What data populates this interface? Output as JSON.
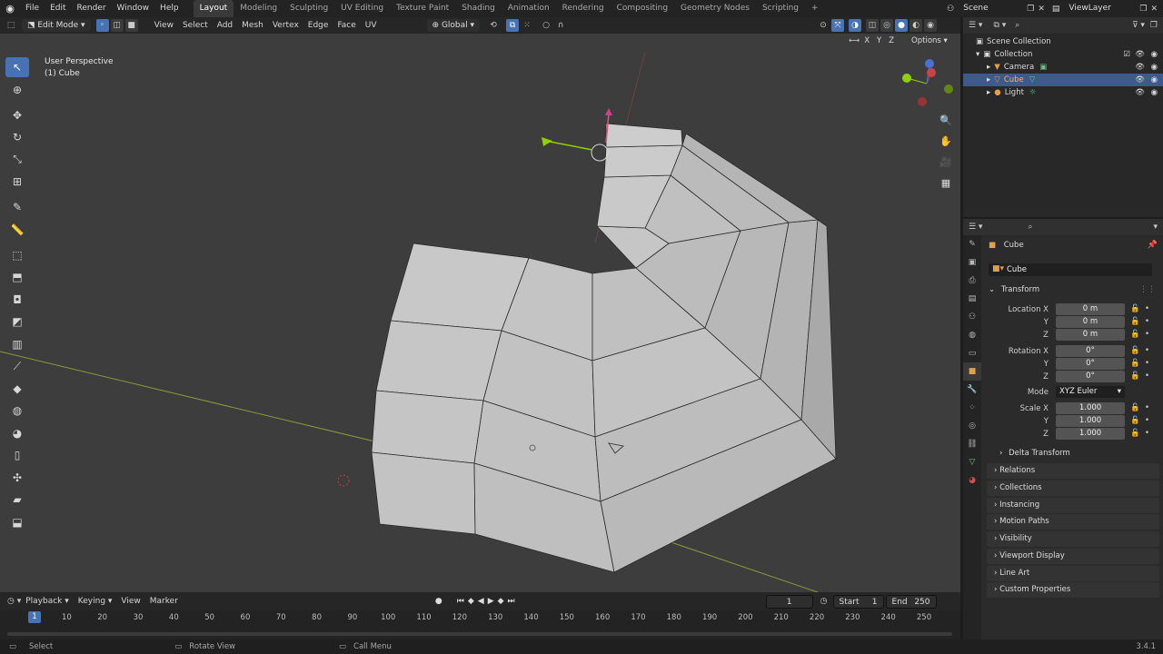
{
  "topbar": {
    "menus": [
      "File",
      "Edit",
      "Render",
      "Window",
      "Help"
    ],
    "workspaces": [
      "Layout",
      "Modeling",
      "Sculpting",
      "UV Editing",
      "Texture Paint",
      "Shading",
      "Animation",
      "Rendering",
      "Compositing",
      "Geometry Nodes",
      "Scripting"
    ],
    "active_workspace": "Layout",
    "add_tab": "+",
    "scene": "Scene",
    "view_layer": "ViewLayer"
  },
  "viewport_header": {
    "mode": "Edit Mode",
    "menus": [
      "View",
      "Select",
      "Add",
      "Mesh",
      "Vertex",
      "Edge",
      "Face",
      "UV"
    ],
    "orientation": "Global",
    "options": "Options"
  },
  "viewport": {
    "perspective": "User Perspective",
    "object": "(1) Cube",
    "xyz": [
      "X",
      "Y",
      "Z"
    ]
  },
  "outliner": {
    "root": "Scene Collection",
    "collection": "Collection",
    "items": [
      "Camera",
      "Cube",
      "Light"
    ],
    "selected": "Cube"
  },
  "properties": {
    "object_name": "Cube",
    "data_name": "Cube",
    "transform_label": "Transform",
    "location_label": "Location X",
    "rotation_label": "Rotation X",
    "scale_label": "Scale X",
    "axis_y": "Y",
    "axis_z": "Z",
    "location": [
      "0 m",
      "0 m",
      "0 m"
    ],
    "rotation": [
      "0°",
      "0°",
      "0°"
    ],
    "mode_label": "Mode",
    "mode_value": "XYZ Euler",
    "scale": [
      "1.000",
      "1.000",
      "1.000"
    ],
    "delta_transform": "Delta Transform",
    "panels": [
      "Relations",
      "Collections",
      "Instancing",
      "Motion Paths",
      "Visibility",
      "Viewport Display",
      "Line Art",
      "Custom Properties"
    ]
  },
  "timeline": {
    "menus": [
      "Playback",
      "Keying",
      "View",
      "Marker"
    ],
    "current_frame": "1",
    "start_label": "Start",
    "start": "1",
    "end_label": "End",
    "end": "250",
    "ticks": [
      {
        "label": "10",
        "f": 10
      },
      {
        "label": "20",
        "f": 20
      },
      {
        "label": "30",
        "f": 30
      },
      {
        "label": "40",
        "f": 40
      },
      {
        "label": "50",
        "f": 50
      },
      {
        "label": "60",
        "f": 60
      },
      {
        "label": "70",
        "f": 70
      },
      {
        "label": "80",
        "f": 80
      },
      {
        "label": "90",
        "f": 90
      },
      {
        "label": "100",
        "f": 100
      },
      {
        "label": "110",
        "f": 110
      },
      {
        "label": "120",
        "f": 120
      },
      {
        "label": "130",
        "f": 130
      },
      {
        "label": "140",
        "f": 140
      },
      {
        "label": "150",
        "f": 150
      },
      {
        "label": "160",
        "f": 160
      },
      {
        "label": "170",
        "f": 170
      },
      {
        "label": "180",
        "f": 180
      },
      {
        "label": "190",
        "f": 190
      },
      {
        "label": "200",
        "f": 200
      },
      {
        "label": "210",
        "f": 210
      },
      {
        "label": "220",
        "f": 220
      },
      {
        "label": "230",
        "f": 230
      },
      {
        "label": "240",
        "f": 240
      },
      {
        "label": "250",
        "f": 250
      }
    ]
  },
  "statusbar": {
    "select": "Select",
    "rotate": "Rotate View",
    "call_menu": "Call Menu",
    "version": "3.4.1"
  },
  "colors": {
    "accent": "#4772b3",
    "viewport_bg": "#3d3d3d",
    "mesh_face": "#c4c4c4"
  }
}
